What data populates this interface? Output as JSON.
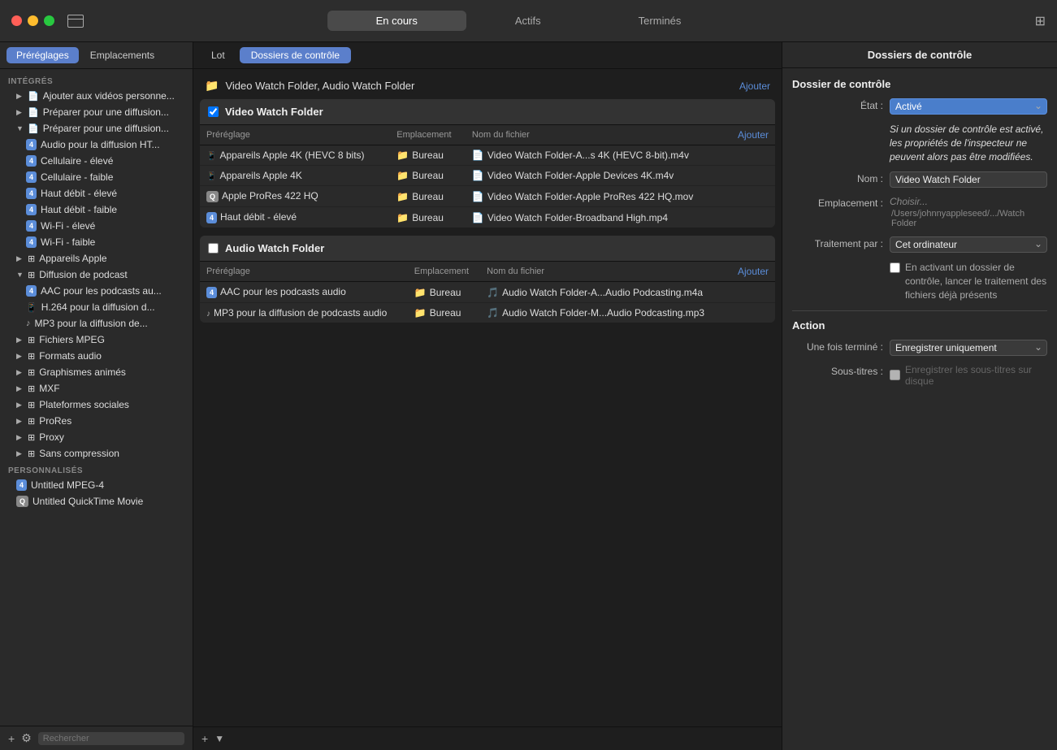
{
  "titleBar": {
    "tabs": [
      "En cours",
      "Actifs",
      "Terminés"
    ],
    "activeTab": "En cours",
    "windowIcon": "grid-icon"
  },
  "sidebar": {
    "tab1": "Préréglages",
    "tab2": "Emplacements",
    "activeTab": "Préréglages",
    "sections": [
      {
        "id": "integres",
        "label": "INTÉGRÉS",
        "items": [
          {
            "id": "ajouter",
            "label": "Ajouter aux vidéos personne...",
            "level": 1,
            "icon": "doc",
            "badge": null,
            "expanded": false
          },
          {
            "id": "preparer1",
            "label": "Préparer pour une diffusion...",
            "level": 1,
            "icon": "doc",
            "badge": null,
            "expanded": false
          },
          {
            "id": "preparer2",
            "label": "Préparer pour une diffusion...",
            "level": 1,
            "icon": "doc",
            "badge": null,
            "expanded": true,
            "selected": false,
            "children": [
              {
                "id": "audio_ht",
                "label": "Audio pour la diffusion HT...",
                "level": 2,
                "badge": "4"
              },
              {
                "id": "cellulaire_eleve",
                "label": "Cellulaire - élevé",
                "level": 2,
                "badge": "4"
              },
              {
                "id": "cellulaire_faible",
                "label": "Cellulaire - faible",
                "level": 2,
                "badge": "4"
              },
              {
                "id": "haut_debit_eleve",
                "label": "Haut débit - élevé",
                "level": 2,
                "badge": "4"
              },
              {
                "id": "haut_debit_faible",
                "label": "Haut débit - faible",
                "level": 2,
                "badge": "4"
              },
              {
                "id": "wifi_eleve",
                "label": "Wi-Fi - élevé",
                "level": 2,
                "badge": "4"
              },
              {
                "id": "wifi_faible",
                "label": "Wi-Fi - faible",
                "level": 2,
                "badge": "4"
              }
            ]
          },
          {
            "id": "appareils_apple",
            "label": "Appareils Apple",
            "level": 1,
            "icon": "group",
            "badge": null,
            "expanded": false
          },
          {
            "id": "diffusion_podcast",
            "label": "Diffusion de podcast",
            "level": 1,
            "icon": "group",
            "badge": null,
            "expanded": true,
            "children": [
              {
                "id": "aac_podcast",
                "label": "AAC pour les podcasts au...",
                "level": 2,
                "badge": "4"
              },
              {
                "id": "h264",
                "label": "H.264 pour la diffusion d...",
                "level": 2,
                "badge": null,
                "phoneIcon": true
              },
              {
                "id": "mp3_podcast",
                "label": "MP3 pour la diffusion de...",
                "level": 2,
                "badge": null,
                "musicIcon": true
              }
            ]
          },
          {
            "id": "fichiers_mpeg",
            "label": "Fichiers MPEG",
            "level": 1,
            "icon": "group",
            "badge": null
          },
          {
            "id": "formats_audio",
            "label": "Formats audio",
            "level": 1,
            "icon": "group",
            "badge": null
          },
          {
            "id": "graphismes",
            "label": "Graphismes animés",
            "level": 1,
            "icon": "group",
            "badge": null
          },
          {
            "id": "mxf",
            "label": "MXF",
            "level": 1,
            "icon": "group",
            "badge": null
          },
          {
            "id": "plateformes",
            "label": "Plateformes sociales",
            "level": 1,
            "icon": "group",
            "badge": null
          },
          {
            "id": "prores",
            "label": "ProRes",
            "level": 1,
            "icon": "group",
            "badge": null
          },
          {
            "id": "proxy",
            "label": "Proxy",
            "level": 1,
            "icon": "group",
            "badge": null
          },
          {
            "id": "sans_compression",
            "label": "Sans compression",
            "level": 1,
            "icon": "group",
            "badge": null
          }
        ]
      },
      {
        "id": "personnalises",
        "label": "PERSONNALISÉS",
        "items": [
          {
            "id": "untitled_mpeg",
            "label": "Untitled MPEG-4",
            "level": 1,
            "badge": "4"
          },
          {
            "id": "untitled_qt",
            "label": "Untitled QuickTime Movie",
            "level": 1,
            "badge": "q"
          }
        ]
      }
    ],
    "footer": {
      "addButton": "+",
      "gearButton": "⚙",
      "searchPlaceholder": "Rechercher"
    }
  },
  "middlePanel": {
    "tabs": [
      "Lot",
      "Dossiers de contrôle"
    ],
    "activeTab": "Dossiers de contrôle",
    "headerTitle": "Dossiers de contrôle",
    "groupHeader": "Video Watch Folder, Audio Watch Folder",
    "addLinkHeader": "Ajouter",
    "groups": [
      {
        "id": "video_watch",
        "name": "Video Watch Folder",
        "checked": true,
        "columns": [
          "Préréglage",
          "Emplacement",
          "Nom du fichier",
          "Ajouter"
        ],
        "rows": [
          {
            "preset": "Appareils Apple 4K (HEVC 8 bits)",
            "presetIcon": "phone",
            "location": "Bureau",
            "filename": "Video Watch Folder-A...s 4K (HEVC 8-bit).m4v"
          },
          {
            "preset": "Appareils Apple 4K",
            "presetIcon": "phone",
            "location": "Bureau",
            "filename": "Video Watch Folder-Apple Devices 4K.m4v"
          },
          {
            "preset": "Apple ProRes 422 HQ",
            "presetIcon": "q",
            "location": "Bureau",
            "filename": "Video Watch Folder-Apple ProRes 422 HQ.mov"
          },
          {
            "preset": "Haut débit - élevé",
            "presetIcon": "4",
            "location": "Bureau",
            "filename": "Video Watch Folder-Broadband High.mp4"
          }
        ]
      },
      {
        "id": "audio_watch",
        "name": "Audio Watch Folder",
        "checked": false,
        "columns": [
          "Préréglage",
          "Emplacement",
          "Nom du fichier",
          "Ajouter"
        ],
        "rows": [
          {
            "preset": "AAC pour les podcasts audio",
            "presetIcon": "4",
            "location": "Bureau",
            "filename": "Audio Watch Folder-A...Audio Podcasting.m4a"
          },
          {
            "preset": "MP3 pour la diffusion de podcasts audio",
            "presetIcon": "music",
            "location": "Bureau",
            "filename": "Audio Watch Folder-M...Audio Podcasting.mp3"
          }
        ]
      }
    ],
    "footer": {
      "addButton": "+"
    }
  },
  "rightPanel": {
    "title": "Dossiers de contrôle",
    "sectionTitle": "Dossier de contrôle",
    "fields": {
      "etat": {
        "label": "État :",
        "value": "Activé",
        "type": "select"
      },
      "etatNote": "Si un dossier de contrôle est activé, les propriétés de l'inspecteur ne peuvent alors pas être modifiées.",
      "nom": {
        "label": "Nom :",
        "value": "Video Watch Folder",
        "type": "input"
      },
      "emplacement": {
        "label": "Emplacement :",
        "chooser": "Choisir...",
        "path": "/Users/johnnyappleseed/.../Watch Folder"
      },
      "traitement": {
        "label": "Traitement par :",
        "value": "Cet ordinateur",
        "type": "select"
      },
      "traitementCheckbox": "En activant un dossier de contrôle, lancer le traitement des fichiers déjà présents"
    },
    "actionSection": {
      "title": "Action",
      "unesFoisTermine": {
        "label": "Une fois terminé :",
        "value": "Enregistrer uniquement"
      },
      "sousTitres": {
        "label": "Sous-titres :",
        "value": "Enregistrer les sous-titres sur disque",
        "disabled": true
      }
    }
  }
}
